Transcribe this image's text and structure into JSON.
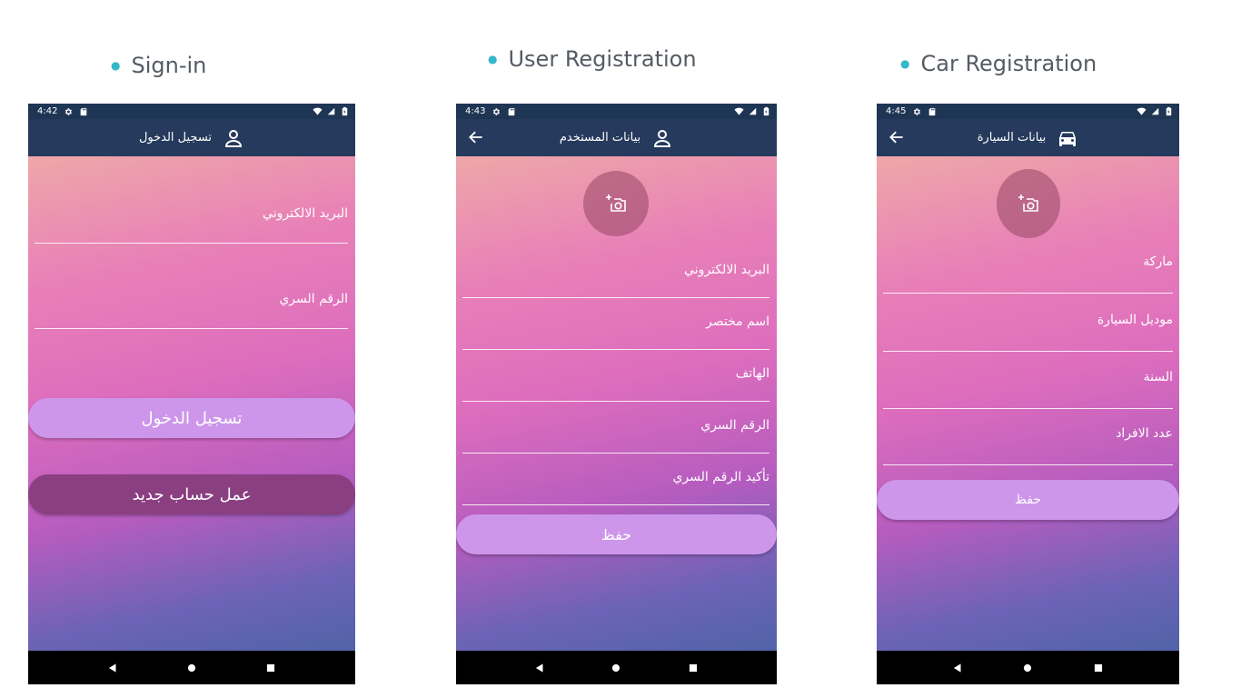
{
  "captions": {
    "signin": "Sign-in",
    "user_registration": "User Registration",
    "car_registration": "Car Registration"
  },
  "signin_screen": {
    "status_time": "4:42",
    "title": "تسجيل الدخول",
    "title_icon": "person-icon",
    "fields": [
      "البريد الالكتروني",
      "الرقم السري"
    ],
    "login_button": "تسجيل الدخول",
    "register_button": "عمل حساب جديد"
  },
  "user_screen": {
    "status_time": "4:43",
    "title": "بيانات المستخدم",
    "title_icon": "person-icon",
    "avatar_icon": "add-photo-icon",
    "fields": [
      "البريد الالكتروني",
      "اسم مختصر",
      "الهاتف",
      "الرقم السري",
      "تأكيد الرقم السري"
    ],
    "save_button": "حفظ"
  },
  "car_screen": {
    "status_time": "4:45",
    "title": "بيانات السيارة",
    "title_icon": "car-icon",
    "avatar_icon": "add-photo-icon",
    "fields": [
      "ماركة",
      "موديل السيارة",
      "السنة",
      "عدد الافراد"
    ],
    "save_button": "حفظ"
  },
  "colors": {
    "app_bar": "#253a5c",
    "button_primary": "#cd96ea",
    "button_secondary": "#8a3f80",
    "caption_dot": "#35b8c9"
  }
}
